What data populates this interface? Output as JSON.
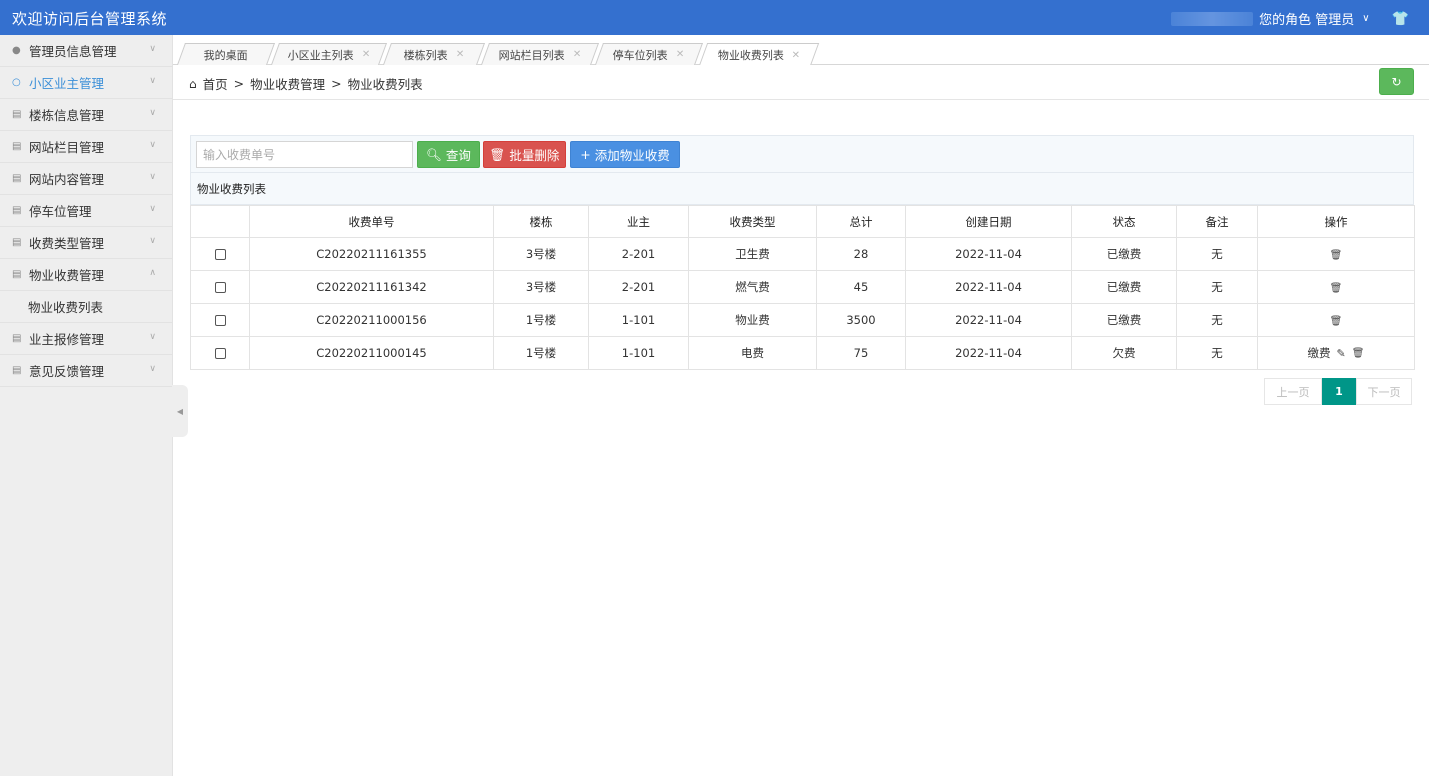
{
  "header": {
    "app_title": "欢迎访问后台管理系统",
    "role_text": "您的角色 管理员",
    "chevron": "chevron-down-icon",
    "shirt": "shirt-icon"
  },
  "sidebar": {
    "items": [
      {
        "label": "管理员信息管理",
        "icon": "user-icon",
        "arrow": "chevron-down-icon"
      },
      {
        "label": "小区业主管理",
        "icon": "person-icon",
        "arrow": "chevron-down-icon"
      },
      {
        "label": "楼栋信息管理",
        "icon": "list-icon",
        "arrow": "chevron-down-icon"
      },
      {
        "label": "网站栏目管理",
        "icon": "list-icon",
        "arrow": "chevron-down-icon"
      },
      {
        "label": "网站内容管理",
        "icon": "list-icon",
        "arrow": "chevron-down-icon"
      },
      {
        "label": "停车位管理",
        "icon": "list-icon",
        "arrow": "chevron-down-icon"
      },
      {
        "label": "收费类型管理",
        "icon": "list-icon",
        "arrow": "chevron-down-icon"
      },
      {
        "label": "物业收费管理",
        "icon": "list-icon",
        "arrow": "chevron-up-icon"
      },
      {
        "label": "物业收费列表"
      },
      {
        "label": "业主报修管理",
        "icon": "list-icon",
        "arrow": "chevron-down-icon"
      },
      {
        "label": "意见反馈管理",
        "icon": "list-icon",
        "arrow": "chevron-down-icon"
      }
    ]
  },
  "tabs": [
    {
      "label": "我的桌面"
    },
    {
      "label": "小区业主列表"
    },
    {
      "label": "楼栋列表"
    },
    {
      "label": "网站栏目列表"
    },
    {
      "label": "停车位列表"
    },
    {
      "label": "物业收费列表"
    }
  ],
  "breadcrumb": {
    "home": "首页",
    "sep": ">",
    "level1": "物业收费管理",
    "level2": "物业收费列表"
  },
  "toolbar": {
    "search_placeholder": "输入收费单号",
    "search_label": "查询",
    "delete_label": "批量删除",
    "add_label": "添加物业收费"
  },
  "list_title": "物业收费列表",
  "table": {
    "columns": [
      "收费单号",
      "楼栋",
      "业主",
      "收费类型",
      "总计",
      "创建日期",
      "状态",
      "备注",
      "操作"
    ],
    "rows": [
      {
        "no": "C20220211161355",
        "building": "3号楼",
        "owner": "2-201",
        "type": "卫生费",
        "total": "28",
        "date": "2022-11-04",
        "status": "已缴费",
        "note": "无",
        "pay": ""
      },
      {
        "no": "C20220211161342",
        "building": "3号楼",
        "owner": "2-201",
        "type": "燃气费",
        "total": "45",
        "date": "2022-11-04",
        "status": "已缴费",
        "note": "无",
        "pay": ""
      },
      {
        "no": "C20220211000156",
        "building": "1号楼",
        "owner": "1-101",
        "type": "物业费",
        "total": "3500",
        "date": "2022-11-04",
        "status": "已缴费",
        "note": "无",
        "pay": ""
      },
      {
        "no": "C20220211000145",
        "building": "1号楼",
        "owner": "1-101",
        "type": "电费",
        "total": "75",
        "date": "2022-11-04",
        "status": "欠费",
        "note": "无",
        "pay": "缴费"
      }
    ]
  },
  "pager": {
    "prev": "上一页",
    "current": "1",
    "next": "下一页"
  }
}
